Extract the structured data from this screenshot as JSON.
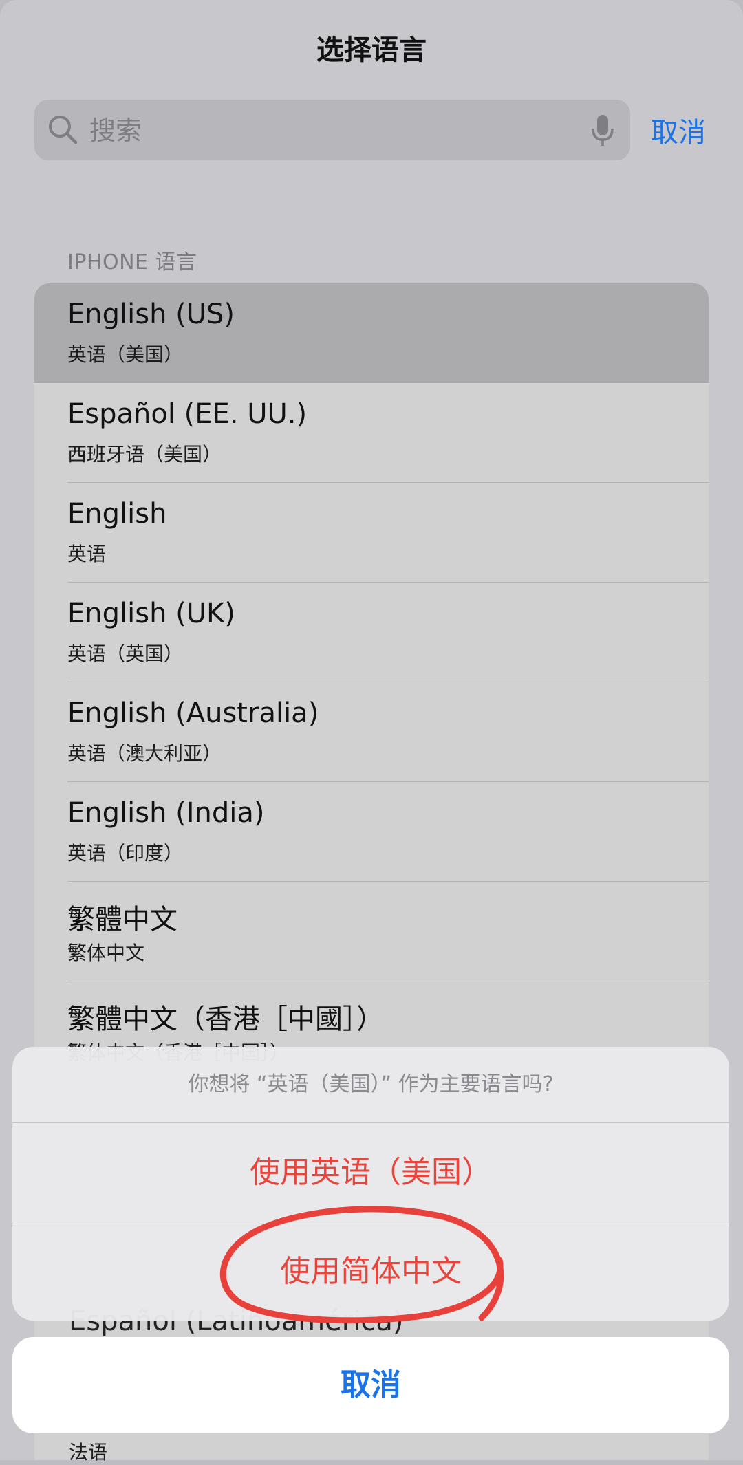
{
  "header": {
    "title": "选择语言",
    "cancel_label": "取消"
  },
  "search": {
    "placeholder": "搜索",
    "value": ""
  },
  "section": {
    "title": "IPHONE 语言"
  },
  "languages": [
    {
      "native": "English (US)",
      "localized": "英语（美国）",
      "selected": true
    },
    {
      "native": "Español (EE. UU.)",
      "localized": "西班牙语（美国）",
      "selected": false
    },
    {
      "native": "English",
      "localized": "英语",
      "selected": false
    },
    {
      "native": "English (UK)",
      "localized": "英语（英国）",
      "selected": false
    },
    {
      "native": "English (Australia)",
      "localized": "英语（澳大利亚）",
      "selected": false
    },
    {
      "native": "English (India)",
      "localized": "英语（印度）",
      "selected": false
    },
    {
      "native": "繁體中文",
      "localized": "繁体中文",
      "selected": false
    },
    {
      "native": "繁體中文（香港［中國］）",
      "localized": "繁体中文（香港［中国］）",
      "selected": false
    }
  ],
  "peek": {
    "under_sheet": "Español (Latinoamérica)",
    "bottom": "法语"
  },
  "action_sheet": {
    "message": "你想将 “英语（美国）” 作为主要语言吗?",
    "use_english": "使用英语（美国）",
    "use_chinese": "使用简体中文",
    "cancel": "取消"
  },
  "colors": {
    "accent_blue": "#1a73e8",
    "destructive_red": "#e8453c",
    "annotation_red": "#e8403a"
  }
}
